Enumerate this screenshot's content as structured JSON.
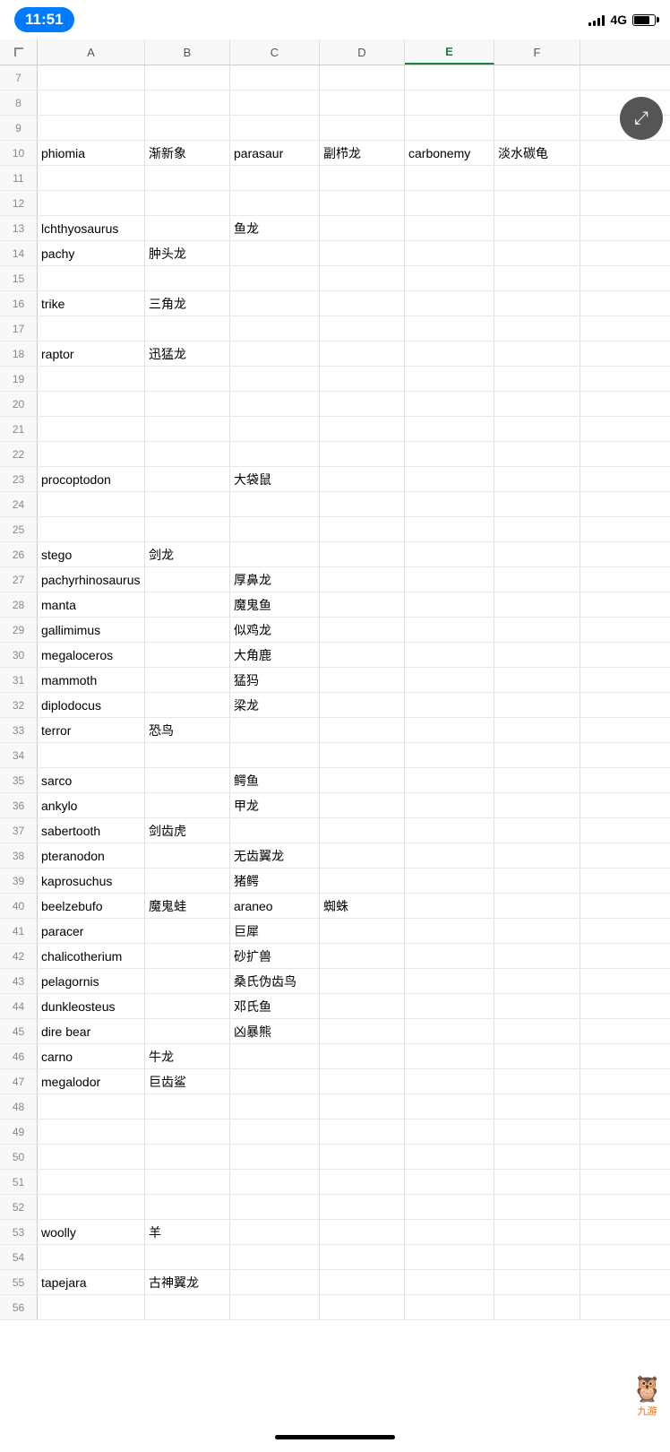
{
  "statusBar": {
    "time": "11:51",
    "network": "4G"
  },
  "columns": [
    {
      "label": "",
      "key": "rownum"
    },
    {
      "label": "A",
      "key": "A"
    },
    {
      "label": "B",
      "key": "B"
    },
    {
      "label": "C",
      "key": "C"
    },
    {
      "label": "D",
      "key": "D"
    },
    {
      "label": "E",
      "key": "E",
      "active": true
    },
    {
      "label": "F",
      "key": "F"
    }
  ],
  "rows": [
    {
      "num": "7",
      "A": "",
      "B": "",
      "C": "",
      "D": "",
      "E": "",
      "F": ""
    },
    {
      "num": "8",
      "A": "",
      "B": "",
      "C": "",
      "D": "",
      "E": "",
      "F": ""
    },
    {
      "num": "9",
      "A": "",
      "B": "",
      "C": "",
      "D": "",
      "E": "",
      "F": ""
    },
    {
      "num": "10",
      "A": "phiomia",
      "B": "渐新象",
      "C": "parasaur",
      "D": "副栉龙",
      "E": "carbonemy",
      "F": "淡水碳龟"
    },
    {
      "num": "11",
      "A": "",
      "B": "",
      "C": "",
      "D": "",
      "E": "",
      "F": ""
    },
    {
      "num": "12",
      "A": "",
      "B": "",
      "C": "",
      "D": "",
      "E": "",
      "F": ""
    },
    {
      "num": "13",
      "A": "lchthyosaurus",
      "B": "",
      "C": "鱼龙",
      "D": "",
      "E": "",
      "F": ""
    },
    {
      "num": "14",
      "A": "pachy",
      "B": "肿头龙",
      "C": "",
      "D": "",
      "E": "",
      "F": ""
    },
    {
      "num": "15",
      "A": "",
      "B": "",
      "C": "",
      "D": "",
      "E": "",
      "F": ""
    },
    {
      "num": "16",
      "A": "trike",
      "B": "三角龙",
      "C": "",
      "D": "",
      "E": "",
      "F": ""
    },
    {
      "num": "17",
      "A": "",
      "B": "",
      "C": "",
      "D": "",
      "E": "",
      "F": ""
    },
    {
      "num": "18",
      "A": "raptor",
      "B": "迅猛龙",
      "C": "",
      "D": "",
      "E": "",
      "F": ""
    },
    {
      "num": "19",
      "A": "",
      "B": "",
      "C": "",
      "D": "",
      "E": "",
      "F": ""
    },
    {
      "num": "20",
      "A": "",
      "B": "",
      "C": "",
      "D": "",
      "E": "",
      "F": ""
    },
    {
      "num": "21",
      "A": "",
      "B": "",
      "C": "",
      "D": "",
      "E": "",
      "F": ""
    },
    {
      "num": "22",
      "A": "",
      "B": "",
      "C": "",
      "D": "",
      "E": "",
      "F": ""
    },
    {
      "num": "23",
      "A": "procoptodon",
      "B": "",
      "C": "大袋鼠",
      "D": "",
      "E": "",
      "F": ""
    },
    {
      "num": "24",
      "A": "",
      "B": "",
      "C": "",
      "D": "",
      "E": "",
      "F": ""
    },
    {
      "num": "25",
      "A": "",
      "B": "",
      "C": "",
      "D": "",
      "E": "",
      "F": ""
    },
    {
      "num": "26",
      "A": "stego",
      "B": "剑龙",
      "C": "",
      "D": "",
      "E": "",
      "F": ""
    },
    {
      "num": "27",
      "A": "pachyrhinosaurus",
      "B": "",
      "C": "厚鼻龙",
      "D": "",
      "E": "",
      "F": ""
    },
    {
      "num": "28",
      "A": "manta",
      "B": "",
      "C": "魔鬼鱼",
      "D": "",
      "E": "",
      "F": ""
    },
    {
      "num": "29",
      "A": "gallimimus",
      "B": "",
      "C": "似鸡龙",
      "D": "",
      "E": "",
      "F": ""
    },
    {
      "num": "30",
      "A": "megaloceros",
      "B": "",
      "C": "大角鹿",
      "D": "",
      "E": "",
      "F": ""
    },
    {
      "num": "31",
      "A": "mammoth",
      "B": "",
      "C": "猛犸",
      "D": "",
      "E": "",
      "F": ""
    },
    {
      "num": "32",
      "A": "diplodocus",
      "B": "",
      "C": "梁龙",
      "D": "",
      "E": "",
      "F": ""
    },
    {
      "num": "33",
      "A": "terror",
      "B": "恐鸟",
      "C": "",
      "D": "",
      "E": "",
      "F": ""
    },
    {
      "num": "34",
      "A": "",
      "B": "",
      "C": "",
      "D": "",
      "E": "",
      "F": ""
    },
    {
      "num": "35",
      "A": "sarco",
      "B": "",
      "C": "鳄鱼",
      "D": "",
      "E": "",
      "F": ""
    },
    {
      "num": "36",
      "A": "ankylo",
      "B": "",
      "C": "甲龙",
      "D": "",
      "E": "",
      "F": ""
    },
    {
      "num": "37",
      "A": "sabertooth",
      "B": "剑齿虎",
      "C": "",
      "D": "",
      "E": "",
      "F": ""
    },
    {
      "num": "38",
      "A": "pteranodon",
      "B": "",
      "C": "无齿翼龙",
      "D": "",
      "E": "",
      "F": ""
    },
    {
      "num": "39",
      "A": "kaprosuchus",
      "B": "",
      "C": "猪鳄",
      "D": "",
      "E": "",
      "F": ""
    },
    {
      "num": "40",
      "A": "beelzebufo",
      "B": "魔鬼蛙",
      "C": "araneo",
      "D": "蜘蛛",
      "E": "",
      "F": ""
    },
    {
      "num": "41",
      "A": "paracer",
      "B": "",
      "C": "巨犀",
      "D": "",
      "E": "",
      "F": ""
    },
    {
      "num": "42",
      "A": "chalicotherium",
      "B": "",
      "C": "砂扩兽",
      "D": "",
      "E": "",
      "F": ""
    },
    {
      "num": "43",
      "A": "pelagornis",
      "B": "",
      "C": "桑氏伪齿鸟",
      "D": "",
      "E": "",
      "F": ""
    },
    {
      "num": "44",
      "A": "dunkleosteus",
      "B": "",
      "C": "邓氏鱼",
      "D": "",
      "E": "",
      "F": ""
    },
    {
      "num": "45",
      "A": "dire bear",
      "B": "",
      "C": "凶暴熊",
      "D": "",
      "E": "",
      "F": ""
    },
    {
      "num": "46",
      "A": "carno",
      "B": "牛龙",
      "C": "",
      "D": "",
      "E": "",
      "F": ""
    },
    {
      "num": "47",
      "A": "megalodor",
      "B": "巨齿鲨",
      "C": "",
      "D": "",
      "E": "",
      "F": ""
    },
    {
      "num": "48",
      "A": "",
      "B": "",
      "C": "",
      "D": "",
      "E": "",
      "F": ""
    },
    {
      "num": "49",
      "A": "",
      "B": "",
      "C": "",
      "D": "",
      "E": "",
      "F": ""
    },
    {
      "num": "50",
      "A": "",
      "B": "",
      "C": "",
      "D": "",
      "E": "",
      "F": ""
    },
    {
      "num": "51",
      "A": "",
      "B": "",
      "C": "",
      "D": "",
      "E": "",
      "F": ""
    },
    {
      "num": "52",
      "A": "",
      "B": "",
      "C": "",
      "D": "",
      "E": "",
      "F": ""
    },
    {
      "num": "53",
      "A": "woolly",
      "B": "羊",
      "C": "",
      "D": "",
      "E": "",
      "F": ""
    },
    {
      "num": "54",
      "A": "",
      "B": "",
      "C": "",
      "D": "",
      "E": "",
      "F": ""
    },
    {
      "num": "55",
      "A": "tapejara",
      "B": "古神翼龙",
      "C": "",
      "D": "",
      "E": "",
      "F": ""
    },
    {
      "num": "56",
      "A": "",
      "B": "",
      "C": "",
      "D": "",
      "E": "",
      "F": ""
    }
  ],
  "expandBtn": {
    "title": "expand"
  },
  "jiuyouLogo": "九游"
}
